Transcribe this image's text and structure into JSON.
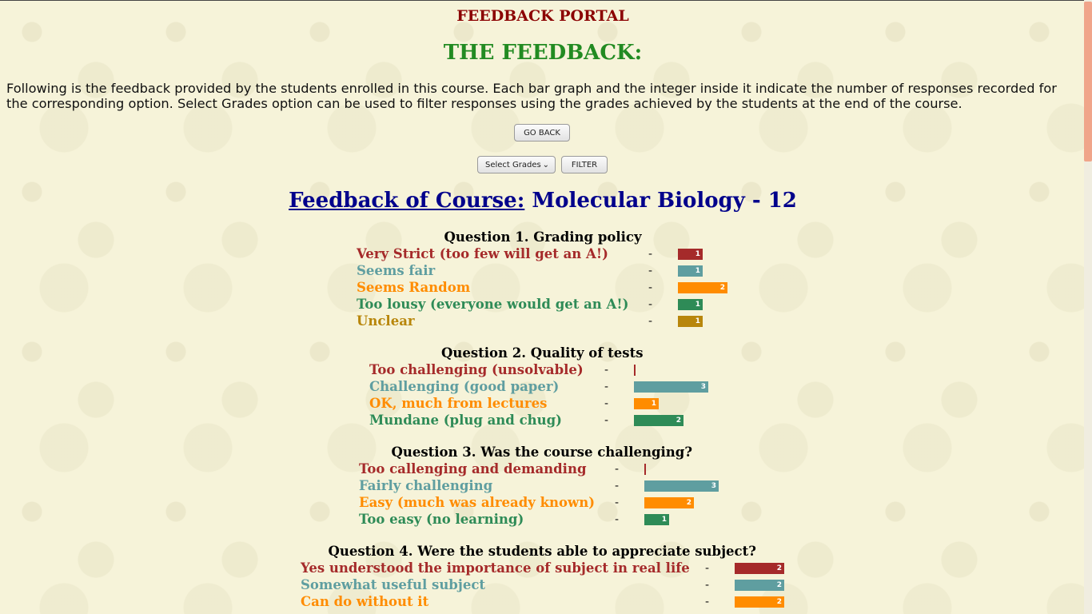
{
  "header": {
    "portal_title": "FEEDBACK PORTAL",
    "heading": "THE FEEDBACK:",
    "description": "Following is the feedback provided by the students enrolled in this course. Each bar graph and the integer inside it indicate the number of responses recorded for the corresponding option. Select Grades option can be used to filter responses using the grades achieved by the students at the end of the course."
  },
  "controls": {
    "go_back": "GO BACK",
    "select_grades": "Select Grades",
    "filter": "FILTER"
  },
  "course": {
    "label": "Feedback of Course:",
    "name": "Molecular Biology - 12"
  },
  "dash": "-",
  "colors": {
    "very_strict": "#a52a2a",
    "seems_fair": "#5f9ea0",
    "random": "#ff8c00",
    "lousy": "#2e8b57",
    "unclear": "#b8860b"
  },
  "questions": [
    {
      "title": "Question 1. Grading policy",
      "options": [
        {
          "label": "Very Strict (too few will get an A!)",
          "count": 1
        },
        {
          "label": "Seems fair",
          "count": 1
        },
        {
          "label": "Seems Random",
          "count": 2
        },
        {
          "label": "Too lousy (everyone would get an A!)",
          "count": 1
        },
        {
          "label": "Unclear",
          "count": 1
        }
      ]
    },
    {
      "title": "Question 2. Quality of tests",
      "options": [
        {
          "label": "Too challenging (unsolvable)",
          "count": 0
        },
        {
          "label": "Challenging (good paper)",
          "count": 3
        },
        {
          "label": "OK, much from lectures",
          "count": 1
        },
        {
          "label": "Mundane (plug and chug)",
          "count": 2
        }
      ]
    },
    {
      "title": "Question 3. Was the course challenging?",
      "options": [
        {
          "label": "Too callenging and demanding",
          "count": 0
        },
        {
          "label": "Fairly challenging",
          "count": 3
        },
        {
          "label": "Easy (much was already known)",
          "count": 2
        },
        {
          "label": "Too easy (no learning)",
          "count": 1
        }
      ]
    },
    {
      "title": "Question 4. Were the students able to appreciate subject?",
      "options": [
        {
          "label": "Yes understood the importance of subject in real life",
          "count": 2
        },
        {
          "label": "Somewhat useful subject",
          "count": 2
        },
        {
          "label": "Can do without it",
          "count": 2
        }
      ]
    }
  ]
}
